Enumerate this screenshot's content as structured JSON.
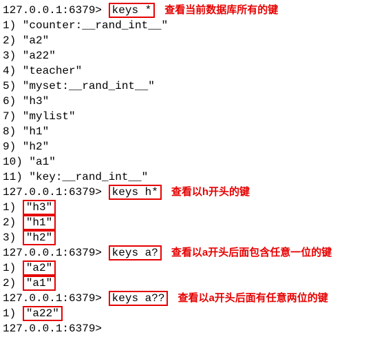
{
  "prompt": "127.0.0.1:6379>",
  "cmd_keys_all": "keys *",
  "comment_keys_all": "查看当前数据库所有的键",
  "res_keys_all": [
    " 1) \"counter:__rand_int__\"",
    " 2) \"a2\"",
    " 3) \"a22\"",
    " 4) \"teacher\"",
    " 5) \"myset:__rand_int__\"",
    " 6) \"h3\"",
    " 7) \"mylist\"",
    " 8) \"h1\"",
    " 9) \"h2\"",
    "10) \"a1\"",
    "11) \"key:__rand_int__\""
  ],
  "cmd_keys_h": "keys h*",
  "comment_keys_h": "查看以h开头的键",
  "res_keys_h_idx": [
    "1) ",
    "2) ",
    "3) "
  ],
  "res_keys_h_val": [
    "\"h3\"",
    "\"h1\"",
    "\"h2\""
  ],
  "cmd_keys_a1": "keys a?",
  "comment_keys_a1": "查看以a开头后面包含任意一位的键",
  "res_keys_a1_idx": [
    "1) ",
    "2) "
  ],
  "res_keys_a1_val": [
    "\"a2\"",
    "\"a1\""
  ],
  "cmd_keys_a2": "keys a??",
  "comment_keys_a2": "查看以a开头后面有任意两位的键",
  "res_keys_a2_idx": [
    "1) "
  ],
  "res_keys_a2_val": [
    "\"a22\""
  ]
}
